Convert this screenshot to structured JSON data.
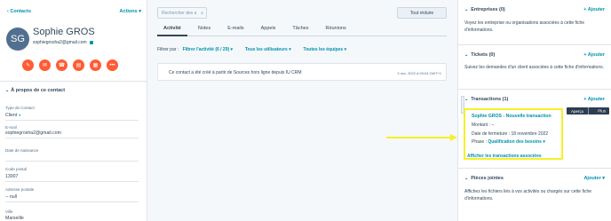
{
  "contact": {
    "back_label": "Contacts",
    "actions_label": "Actions",
    "initials": "SG",
    "name": "Sophie GROS",
    "email": "sophiegrosha2@gmail.com",
    "action_icons": [
      "note-icon",
      "email-icon",
      "call-icon",
      "task-icon",
      "meeting-icon",
      "more-icon"
    ]
  },
  "about": {
    "title": "À propos de ce contact",
    "fields": [
      {
        "label": "Type de Contact",
        "value": "Client",
        "dropdown": true
      },
      {
        "label": "E-mail",
        "value": "sophiegrosha2@gmail.com",
        "dropdown": false
      },
      {
        "label": "Date de naissance",
        "value": "",
        "dropdown": false
      },
      {
        "label": "Code postal",
        "value": "13007",
        "dropdown": false
      },
      {
        "label": "Adresse postale",
        "value": "-- null",
        "dropdown": false
      },
      {
        "label": "Ville",
        "value": "Marseille",
        "dropdown": false
      }
    ]
  },
  "middle": {
    "search_placeholder": "Rechercher des a",
    "collapse_label": "Tout réduire",
    "tabs": [
      "Activité",
      "Notes",
      "E-mails",
      "Appels",
      "Tâches",
      "Réunions"
    ],
    "active_tab": 0,
    "filter_label": "Filtrer par :",
    "filter_activity": "Filtrer l'activité (6 / 29)",
    "filter_users": "Tous les utilisateurs",
    "filter_teams": "Toutes les équipes",
    "activity_text": "Ce contact a été créé à partir de Sources hors ligne depuis IU CRM",
    "activity_date": "3 nov. 2022 à 09:04 GMT+1"
  },
  "right": {
    "companies_title": "Entreprises (0)",
    "companies_desc": "Voyez les entreprise ou organisations associées à cette fiche d'informations.",
    "tickets_title": "Tickets (0)",
    "tickets_desc": "Suivez les demandes d'un client associées à cette fiche d'informations.",
    "deals_title": "Transactions (1)",
    "add_label": "+ Ajouter",
    "preview_label": "Aperçu",
    "more_label": "Plus",
    "deal": {
      "name": "Sophie GROS - Nouvelle transaction",
      "amount": "Montant : --",
      "close_date": "Date de fermeture : 18 novembre 2022",
      "phase_label": "Phase :",
      "phase_value": "Qualification des besoins"
    },
    "show_deals": "Afficher les transactions associées",
    "attachments_title": "Pièces jointes",
    "attachments_add": "Ajouter",
    "attachments_desc": "Affichez les fichiers liés à vos activités ou chargés sur cette fiche d'informations."
  },
  "colors": {
    "accent": "#0091ae",
    "action_orange": "#ff5c35",
    "highlight": "#f5f02a"
  }
}
